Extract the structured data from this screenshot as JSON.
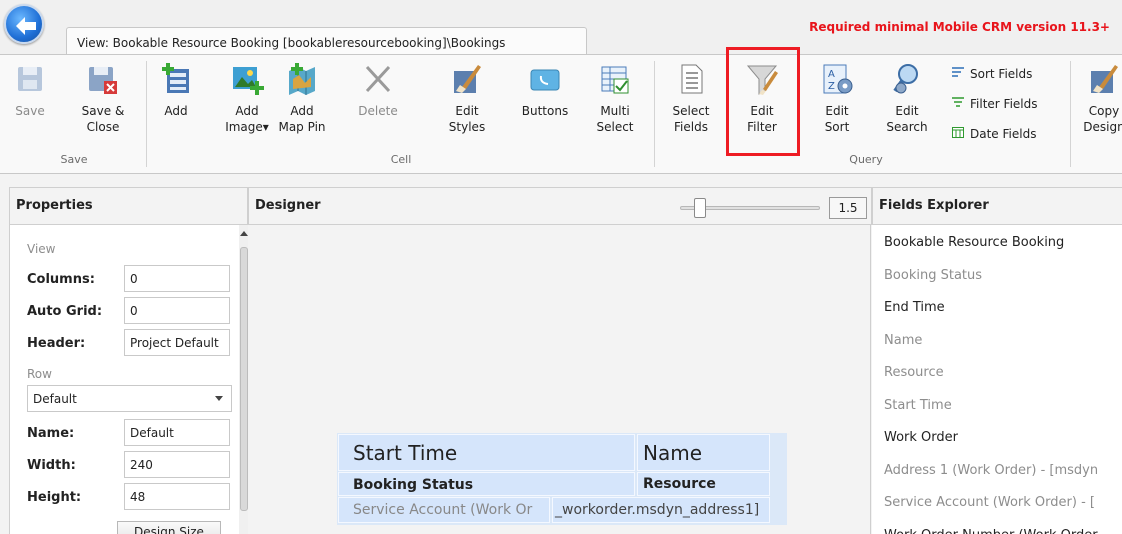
{
  "window": {
    "tab_title": "View: Bookable Resource Booking [bookableresourcebooking]\\Bookings",
    "required_note": "Required minimal Mobile CRM version 11.3+"
  },
  "ribbon": {
    "save": "Save",
    "save_close_1": "Save &",
    "save_close_2": "Close",
    "group_save": "Save",
    "add": "Add",
    "add_image_1": "Add",
    "add_image_2": "Image▾",
    "add_map_pin_1": "Add",
    "add_map_pin_2": "Map Pin",
    "delete": "Delete",
    "edit_styles_1": "Edit",
    "edit_styles_2": "Styles",
    "buttons": "Buttons",
    "multi_select_1": "Multi",
    "multi_select_2": "Select",
    "group_cell": "Cell",
    "select_fields_1": "Select",
    "select_fields_2": "Fields",
    "edit_filter_1": "Edit",
    "edit_filter_2": "Filter",
    "edit_sort_1": "Edit",
    "edit_sort_2": "Sort",
    "edit_search_1": "Edit",
    "edit_search_2": "Search",
    "sort_fields": "Sort Fields",
    "filter_fields": "Filter Fields",
    "date_fields": "Date Fields",
    "group_query": "Query",
    "copy_design_1": "Copy",
    "copy_design_2": "Design"
  },
  "panes": {
    "properties": "Properties",
    "designer": "Designer",
    "fields_explorer": "Fields Explorer",
    "zoom": "1.5"
  },
  "properties": {
    "section_view": "View",
    "columns_label": "Columns:",
    "columns_value": "0",
    "auto_grid_label": "Auto Grid:",
    "auto_grid_value": "0",
    "header_label": "Header:",
    "header_value": "Project Default",
    "section_row": "Row",
    "row_style": "Default",
    "name_label": "Name:",
    "name_value": "Default",
    "width_label": "Width:",
    "width_value": "240",
    "height_label": "Height:",
    "height_value": "48",
    "design_size": "Design Size"
  },
  "row_preview": {
    "start_time": "Start Time",
    "name": "Name",
    "booking_status": "Booking Status",
    "resource": "Resource",
    "service_account": "Service Account (Work Or",
    "address": "_workorder.msdyn_address1]"
  },
  "fields": [
    {
      "label": "Bookable Resource Booking",
      "dim": false
    },
    {
      "label": "Booking Status",
      "dim": true
    },
    {
      "label": "End Time",
      "dim": false
    },
    {
      "label": "Name",
      "dim": true
    },
    {
      "label": "Resource",
      "dim": true
    },
    {
      "label": "Start Time",
      "dim": true
    },
    {
      "label": "Work Order",
      "dim": false
    },
    {
      "label": "Address 1 (Work Order) - [msdyn",
      "dim": true
    },
    {
      "label": "Service Account (Work Order) - [",
      "dim": true
    },
    {
      "label": "Work Order Number (Work Order",
      "dim": false
    }
  ],
  "colors": {
    "highlight": "#ee1c24",
    "required_note": "#e8141b",
    "preview_cell": "#d5e5fb"
  }
}
